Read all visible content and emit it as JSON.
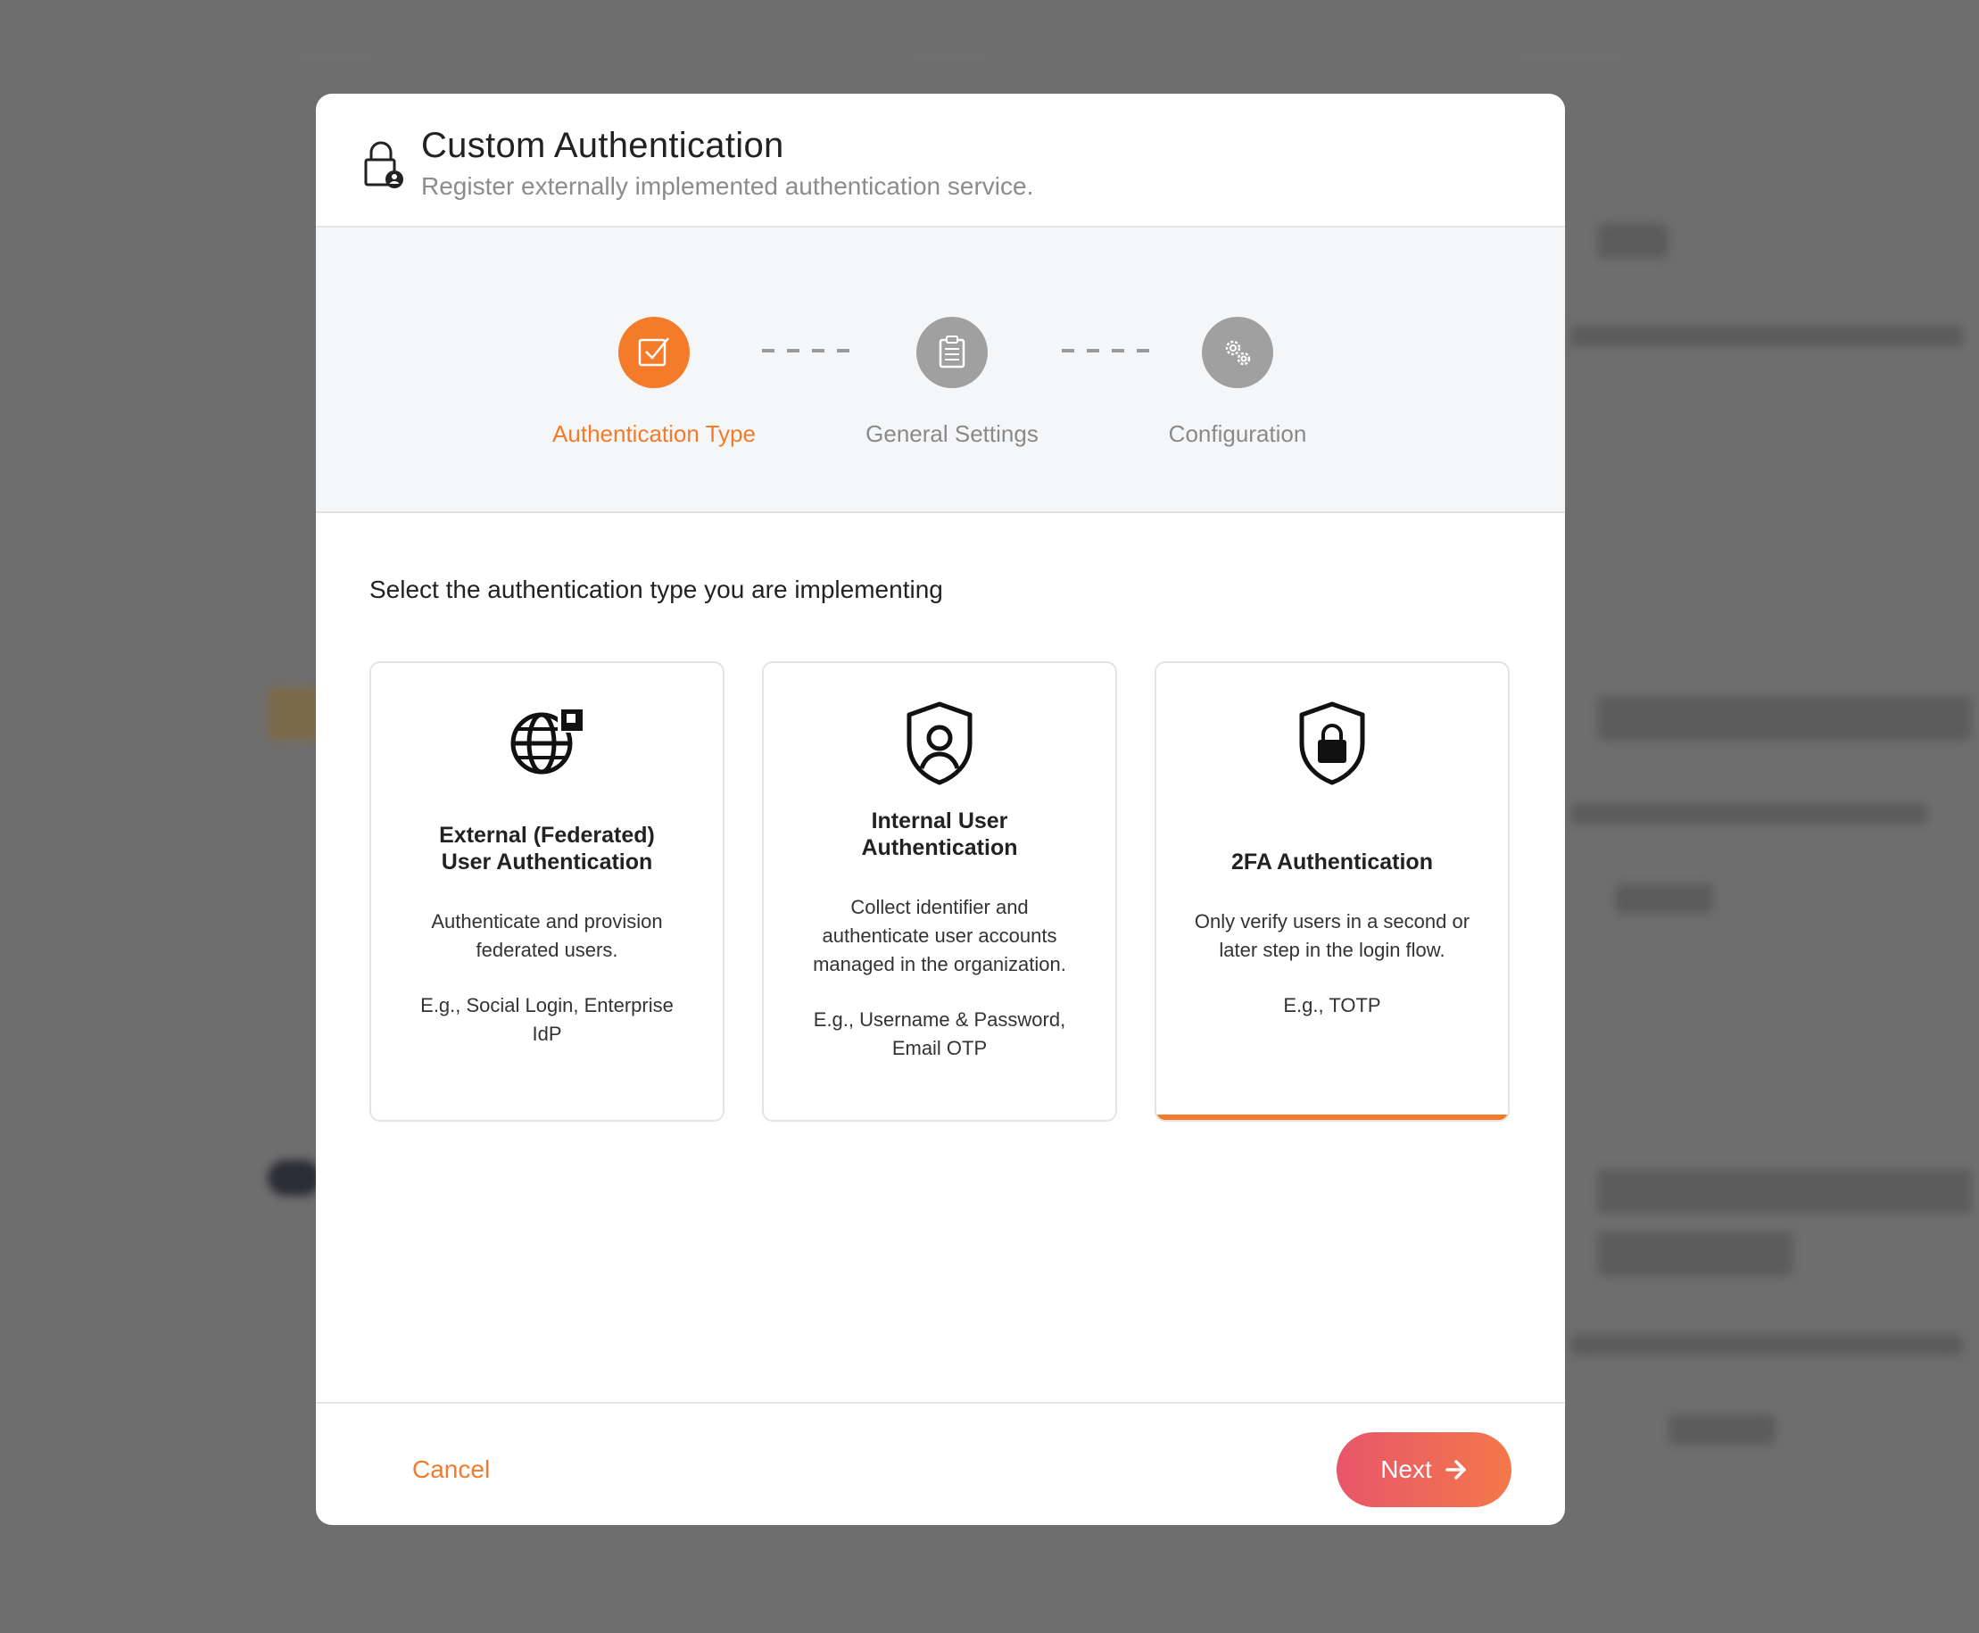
{
  "modal": {
    "title": "Custom Authentication",
    "subtitle": "Register externally implemented authentication service."
  },
  "stepper": {
    "steps": [
      {
        "label": "Authentication Type",
        "state": "active",
        "icon": "checkbox-icon"
      },
      {
        "label": "General Settings",
        "state": "pending",
        "icon": "clipboard-icon"
      },
      {
        "label": "Configuration",
        "state": "pending",
        "icon": "gears-icon"
      }
    ]
  },
  "prompt": "Select the authentication type you are implementing",
  "cards": [
    {
      "title_line1": "External (Federated)",
      "title_line2": "User Authentication",
      "desc_line1": "Authenticate and provision",
      "desc_line2": "federated users.",
      "eg_line1": "E.g., Social Login, Enterprise",
      "eg_line2": "IdP",
      "icon": "globe-icon",
      "selected": false
    },
    {
      "title_line1": "Internal User",
      "title_line2": "Authentication",
      "desc_line1": "Collect identifier and",
      "desc_line2": "authenticate user accounts",
      "desc_line3": "managed in the organization.",
      "eg_line1": "E.g., Username & Password,",
      "eg_line2": "Email OTP",
      "icon": "shield-user-icon",
      "selected": false
    },
    {
      "title_line1": "2FA Authentication",
      "desc_line1": "Only verify users in a second or",
      "desc_line2": "later step in the login flow.",
      "eg_line1": "E.g., TOTP",
      "icon": "shield-lock-icon",
      "selected": true
    }
  ],
  "footer": {
    "cancel_label": "Cancel",
    "next_label": "Next"
  },
  "colors": {
    "accent": "#f47b2a",
    "next_gradient_start": "#e8566a",
    "next_gradient_end": "#f3784a"
  }
}
